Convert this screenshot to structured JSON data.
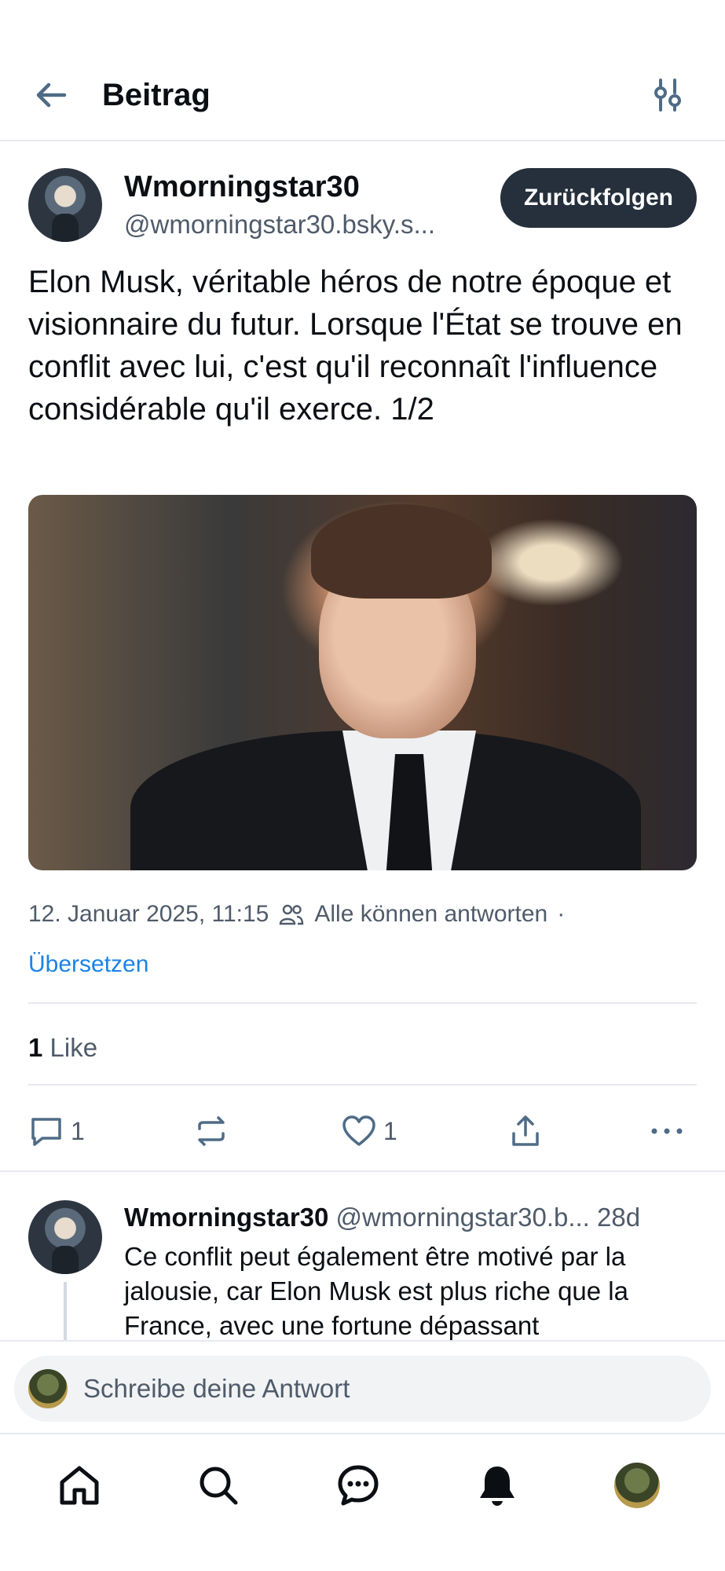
{
  "header": {
    "title": "Beitrag",
    "back_icon": "arrow-left-icon",
    "filter_icon": "sliders-icon"
  },
  "post": {
    "author_name": "Wmorningstar30",
    "author_handle": "@wmorningstar30.bsky.s...",
    "follow_label": "Zurückfolgen",
    "text": "Elon Musk, véritable héros de notre époque et visionnaire du futur. Lorsque l'État se trouve en conflit avec lui, c'est qu'il reconnaît l'influence considérable qu'il exerce. 1/2",
    "timestamp": "12. Januar 2025, 11:15",
    "reply_setting": "Alle können antworten",
    "separator": "·",
    "translate_label": "Übersetzen",
    "like_count": "1",
    "like_label": "Like",
    "actions": {
      "reply_count": "1",
      "like_count": "1"
    }
  },
  "reply": {
    "author_name": "Wmorningstar30",
    "author_handle": "@wmorningstar30.b...",
    "age": "28d",
    "text": "Ce conflit peut également être motivé par la jalousie, car Elon Musk est plus riche que la France, avec une fortune dépassant"
  },
  "composer": {
    "placeholder": "Schreibe deine Antwort"
  },
  "tabbar": {
    "items": [
      "home-icon",
      "search-icon",
      "chat-icon",
      "bell-icon",
      "profile-avatar"
    ]
  },
  "colors": {
    "accent_link": "#1a83e6",
    "button_dark": "#25303c",
    "muted_text": "#4f5b6a"
  }
}
